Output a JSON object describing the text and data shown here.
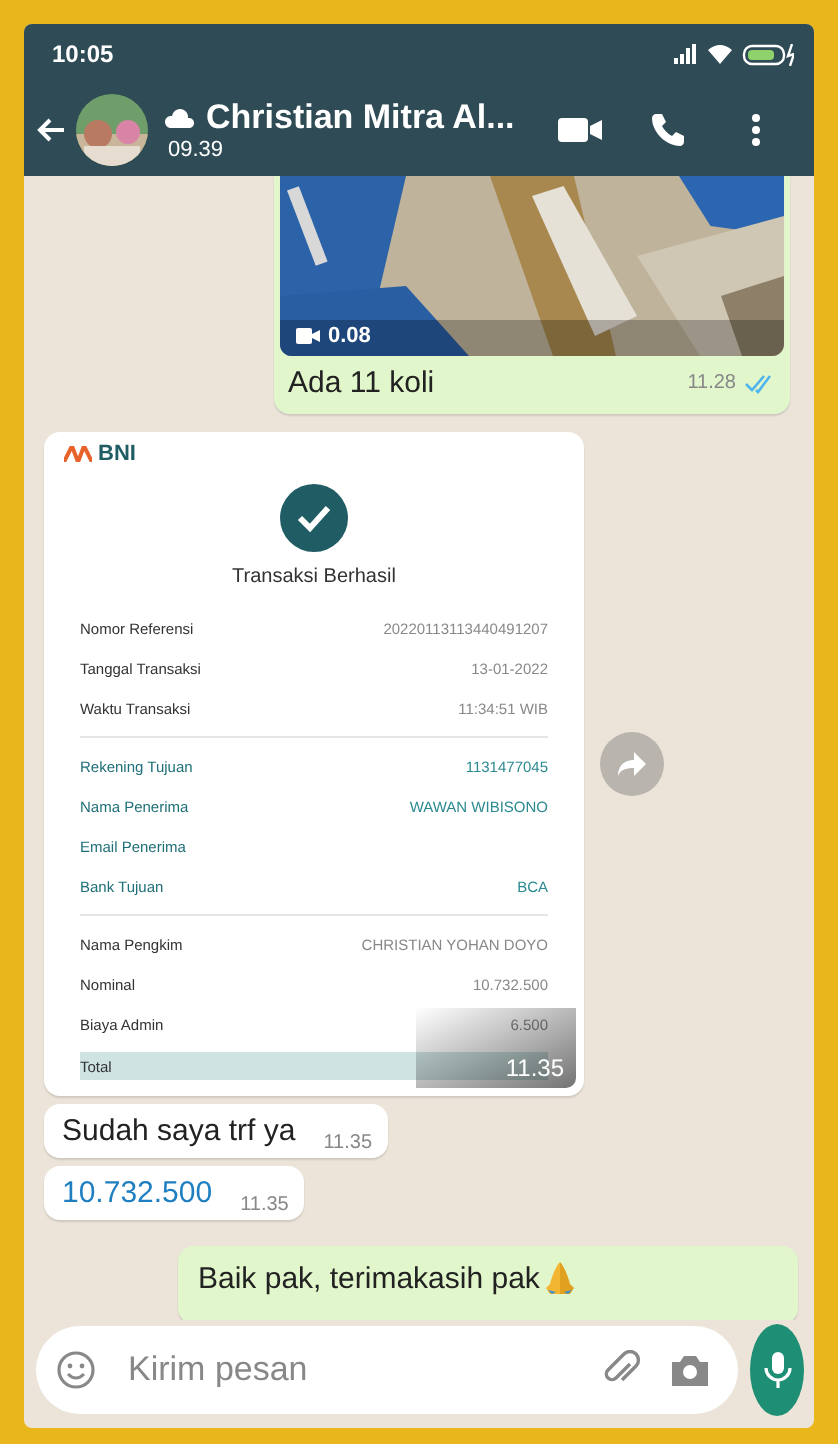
{
  "status_bar": {
    "time": "10:05"
  },
  "header": {
    "name": "Christian Mitra Al...",
    "subtitle": "09.39"
  },
  "messages": [
    {
      "kind": "video",
      "outgoing": true,
      "duration": "0.08",
      "caption": "Ada 11 koli",
      "time": "11.28",
      "read": true
    },
    {
      "kind": "receipt",
      "outgoing": false,
      "time": "11.35",
      "receipt": {
        "logo": "BNI",
        "title": "Transaksi Berhasil",
        "sections": [
          {
            "accent": false,
            "rows": [
              {
                "label": "Nomor Referensi",
                "value": "20220113113440491207"
              },
              {
                "label": "Tanggal Transaksi",
                "value": "13-01-2022"
              },
              {
                "label": "Waktu Transaksi",
                "value": "11:34:51 WIB"
              }
            ]
          },
          {
            "accent": true,
            "rows": [
              {
                "label": "Rekening Tujuan",
                "value": "1131477045"
              },
              {
                "label": "Nama Penerima",
                "value": "WAWAN WIBISONO"
              },
              {
                "label": "Email Penerima"
              },
              {
                "label": "Bank Tujuan",
                "value": "BCA"
              }
            ]
          },
          {
            "accent": false,
            "rows": [
              {
                "label": "Nama Pengkim",
                "value": "CHRISTIAN YOHAN DOYO"
              },
              {
                "label": "Nominal",
                "value": "10.732.500"
              },
              {
                "label": "Biaya Admin",
                "value": "6.500"
              },
              {
                "label": "Total",
                "total": true
              }
            ]
          }
        ]
      }
    },
    {
      "kind": "text",
      "outgoing": false,
      "text": "Sudah saya trf ya",
      "time": "11.35"
    },
    {
      "kind": "link",
      "outgoing": false,
      "text": "10.732.500",
      "time": "11.35"
    },
    {
      "kind": "text",
      "outgoing": true,
      "text": "Baik pak, terimakasih pak",
      "emoji": true
    }
  ],
  "composer": {
    "placeholder": "Kirim pesan"
  }
}
